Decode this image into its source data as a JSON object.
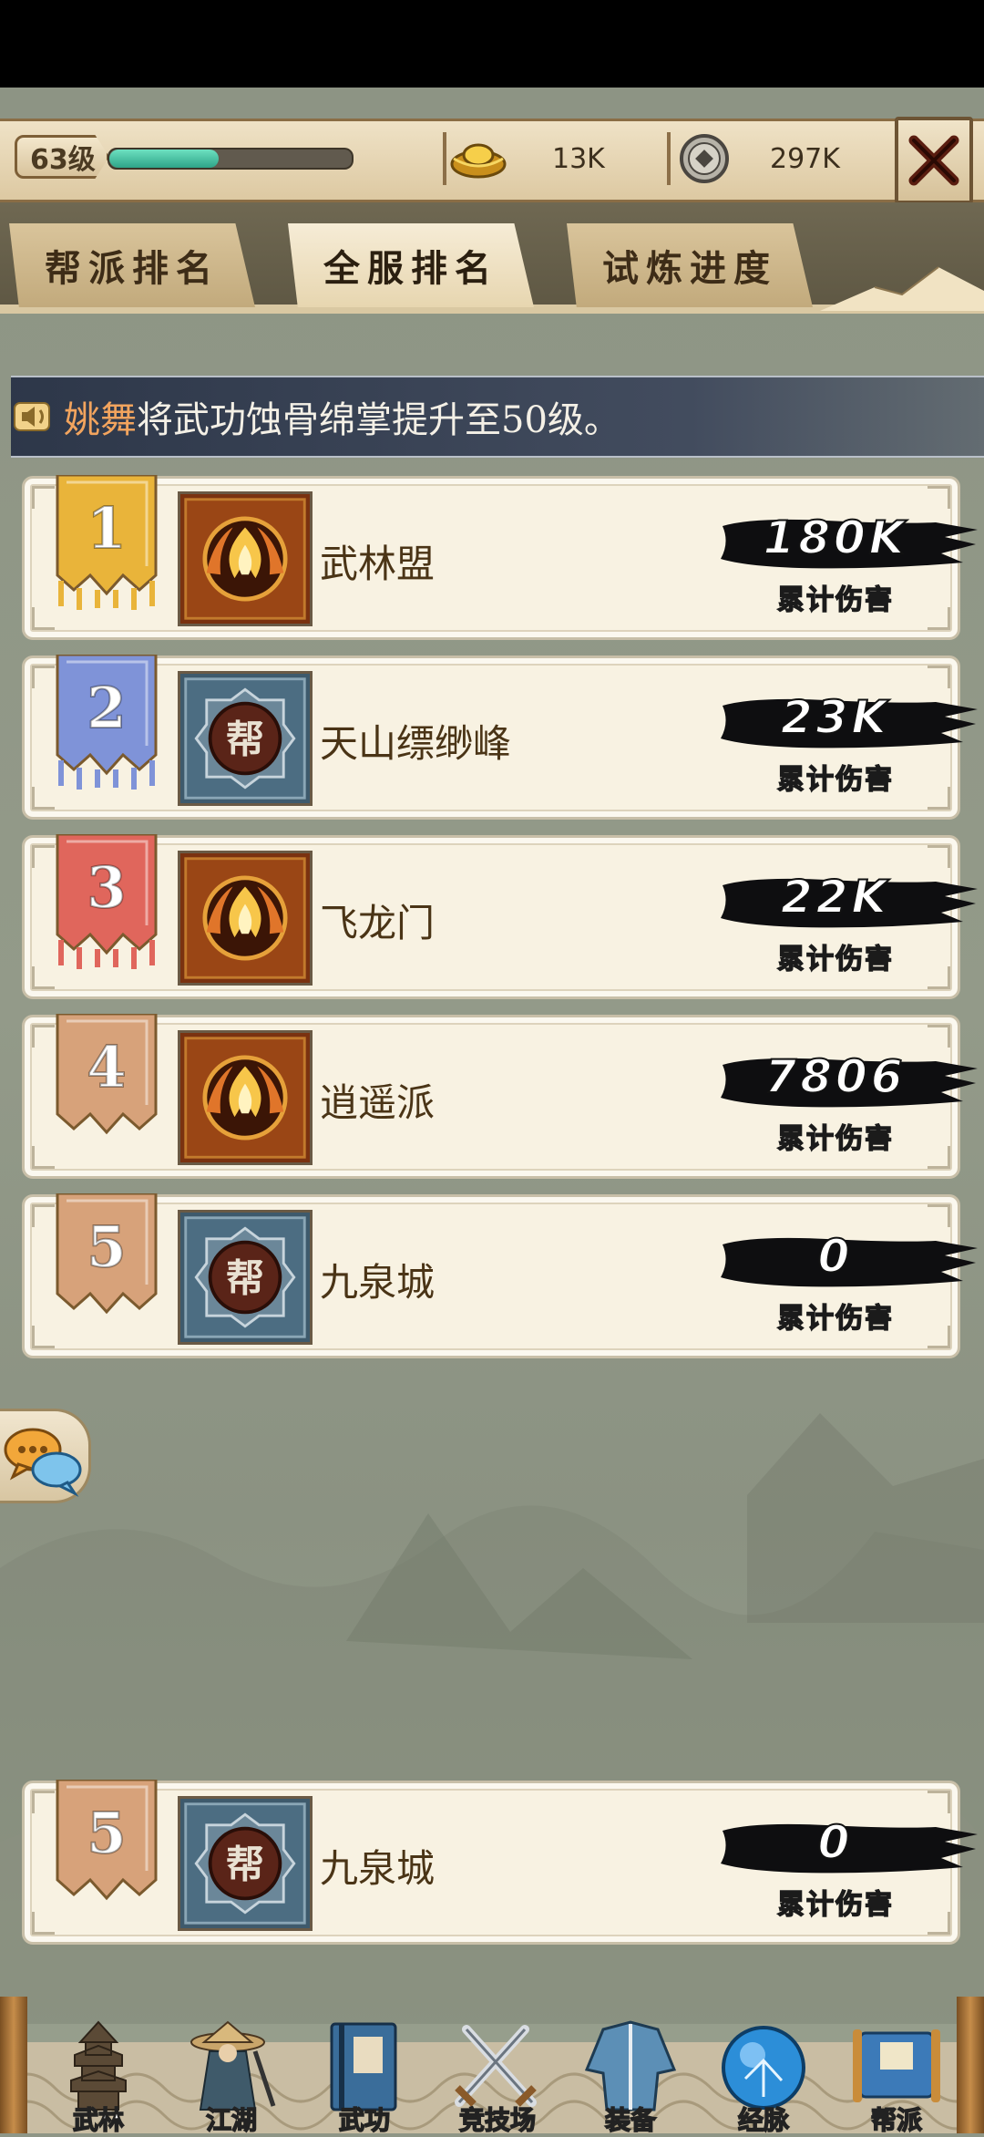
{
  "header": {
    "level_label": "63级",
    "xp_progress": 0.45,
    "gold_value": "13K",
    "coin_value": "297K"
  },
  "tabs": [
    {
      "label": "帮派排名",
      "active": false
    },
    {
      "label": "全服排名",
      "active": true
    },
    {
      "label": "试炼进度",
      "active": false
    }
  ],
  "notice": {
    "name": "姚舞",
    "text": "将武功蚀骨绵掌提升至50级。"
  },
  "rankings": [
    {
      "rank": "1",
      "name": "武林盟",
      "emblem": "flame-emblem",
      "score": "180K",
      "score_label": "累计伤害",
      "banner_color": "#e9b43a"
    },
    {
      "rank": "2",
      "name": "天山缥缈峰",
      "emblem": "bang-emblem",
      "score": "23K",
      "score_label": "累计伤害",
      "banner_color": "#7f93d8"
    },
    {
      "rank": "3",
      "name": "飞龙门",
      "emblem": "flame-emblem",
      "score": "22K",
      "score_label": "累计伤害",
      "banner_color": "#e0665c"
    },
    {
      "rank": "4",
      "name": "逍遥派",
      "emblem": "flame-emblem",
      "score": "7806",
      "score_label": "累计伤害",
      "banner_color": "#d7a27a"
    },
    {
      "rank": "5",
      "name": "九泉城",
      "emblem": "bang-emblem",
      "score": "0",
      "score_label": "累计伤害",
      "banner_color": "#d7a27a"
    }
  ],
  "my_guild": {
    "rank": "5",
    "name": "九泉城",
    "emblem": "bang-emblem",
    "score": "0",
    "score_label": "累计伤害",
    "banner_color": "#d7a27a"
  },
  "bottom_nav": [
    {
      "label": "武林",
      "icon": "pagoda-icon"
    },
    {
      "label": "江湖",
      "icon": "swordsman-icon"
    },
    {
      "label": "武功",
      "icon": "book-icon"
    },
    {
      "label": "竞技场",
      "icon": "crossed-swords-icon"
    },
    {
      "label": "装备",
      "icon": "robe-icon"
    },
    {
      "label": "经脉",
      "icon": "meridian-orb-icon"
    },
    {
      "label": "帮派",
      "icon": "guild-scroll-icon"
    }
  ],
  "colors": {
    "flame_emblem_bg": "#8a3a10",
    "bang_emblem_bg": "#4a6b80",
    "xp_fill": "#3fbf9e"
  }
}
